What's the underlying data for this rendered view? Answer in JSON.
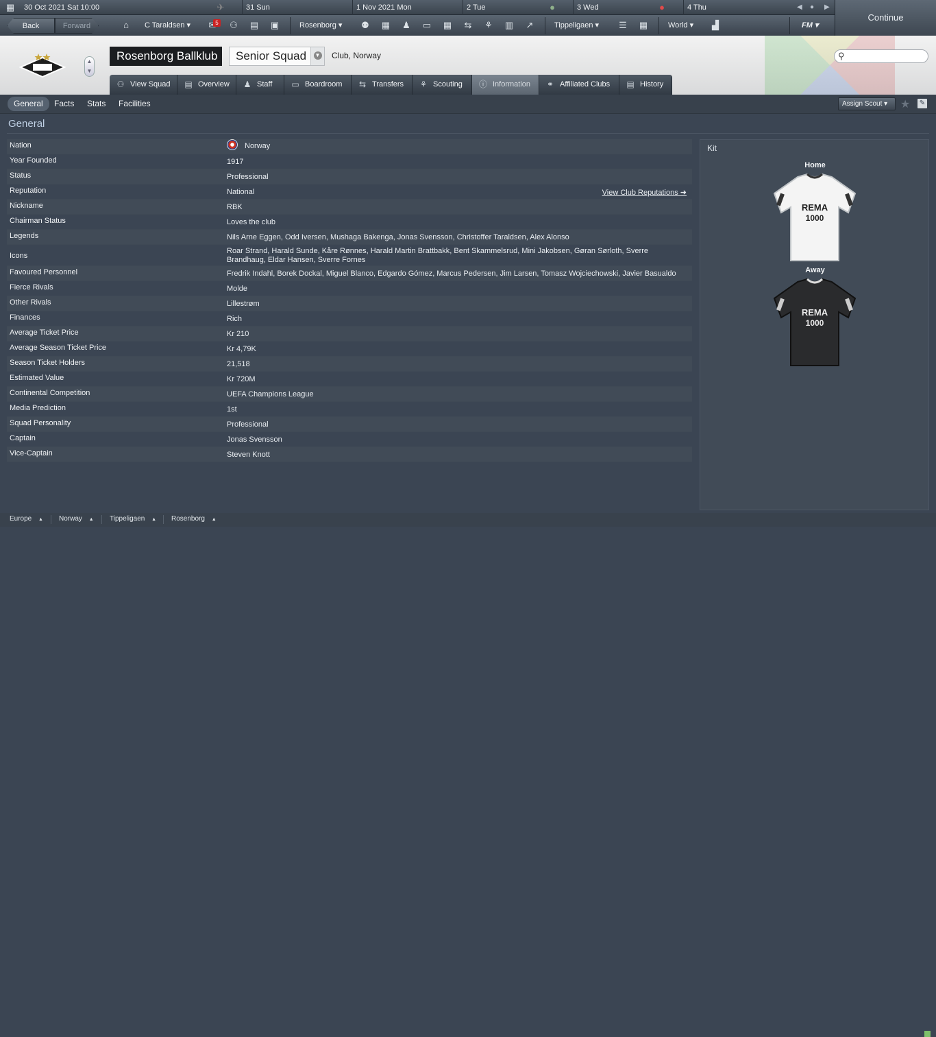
{
  "calendar": {
    "current_date": "30 Oct 2021  Sat  10:00",
    "days": [
      "31 Sun",
      "1 Nov 2021 Mon",
      "2 Tue",
      "3 Wed",
      "4 Thu"
    ]
  },
  "nav": {
    "back": "Back",
    "forward": "Forward",
    "manager": "C Taraldsen",
    "inbox_count": "5",
    "club": "Rosenborg",
    "league": "Tippeligaen",
    "world": "World",
    "fm": "FM",
    "continue": "Continue"
  },
  "header": {
    "club_name": "Rosenborg Ballklub",
    "squad_select": "Senior Squad",
    "club_nation": "Club, Norway"
  },
  "tabs": [
    "View Squad",
    "Overview",
    "Staff",
    "Boardroom",
    "Transfers",
    "Scouting",
    "Information",
    "Affiliated Clubs",
    "History"
  ],
  "subtabs": [
    "General",
    "Facts",
    "Stats",
    "Facilities"
  ],
  "assign_scout": "Assign Scout",
  "section_title": "General",
  "rows": [
    {
      "label": "Nation",
      "value": "Norway"
    },
    {
      "label": "Year Founded",
      "value": "1917"
    },
    {
      "label": "Status",
      "value": "Professional"
    },
    {
      "label": "Reputation",
      "value": "National"
    },
    {
      "label": "Nickname",
      "value": "RBK"
    },
    {
      "label": "Chairman Status",
      "value": "Loves the club"
    },
    {
      "label": "Legends",
      "value": "Nils Arne Eggen, Odd Iversen, Mushaga Bakenga, Jonas Svensson, Christoffer Taraldsen, Alex Alonso"
    },
    {
      "label": "Icons",
      "value": "Roar Strand, Harald Sunde, Kåre Rønnes, Harald Martin Brattbakk, Bent Skammelsrud, Mini Jakobsen, Gøran Sørloth, Sverre Brandhaug, Eldar Hansen, Sverre Fornes"
    },
    {
      "label": "Favoured Personnel",
      "value": "Fredrik Indahl, Borek Dockal, Miguel Blanco, Edgardo Gómez, Marcus Pedersen, Jim Larsen, Tomasz Wojciechowski, Javier Basualdo"
    },
    {
      "label": "Fierce Rivals",
      "value": "Molde"
    },
    {
      "label": "Other Rivals",
      "value": "Lillestrøm"
    },
    {
      "label": "Finances",
      "value": "Rich"
    },
    {
      "label": "Average Ticket Price",
      "value": "Kr 210"
    },
    {
      "label": "Average Season Ticket Price",
      "value": "Kr 4,79K"
    },
    {
      "label": "Season Ticket Holders",
      "value": "21,518"
    },
    {
      "label": "Estimated Value",
      "value": "Kr 720M"
    },
    {
      "label": "Continental Competition",
      "value": "UEFA Champions League"
    },
    {
      "label": "Media Prediction",
      "value": "1st"
    },
    {
      "label": "Squad Personality",
      "value": "Professional"
    },
    {
      "label": "Captain",
      "value": "Jonas Svensson"
    },
    {
      "label": "Vice-Captain",
      "value": "Steven Knott"
    }
  ],
  "reputation_link": "View Club Reputations",
  "kit": {
    "title": "Kit",
    "home": "Home",
    "away": "Away",
    "sponsor_line1": "REMA",
    "sponsor_line2": "1000"
  },
  "footer": [
    "Europe",
    "Norway",
    "Tippeligaen",
    "Rosenborg"
  ],
  "colors": {
    "background": "#3b4553",
    "row_alt": "#414b57",
    "section_title": "#bfd0e4",
    "club_name_bg": "#1b1d20"
  }
}
